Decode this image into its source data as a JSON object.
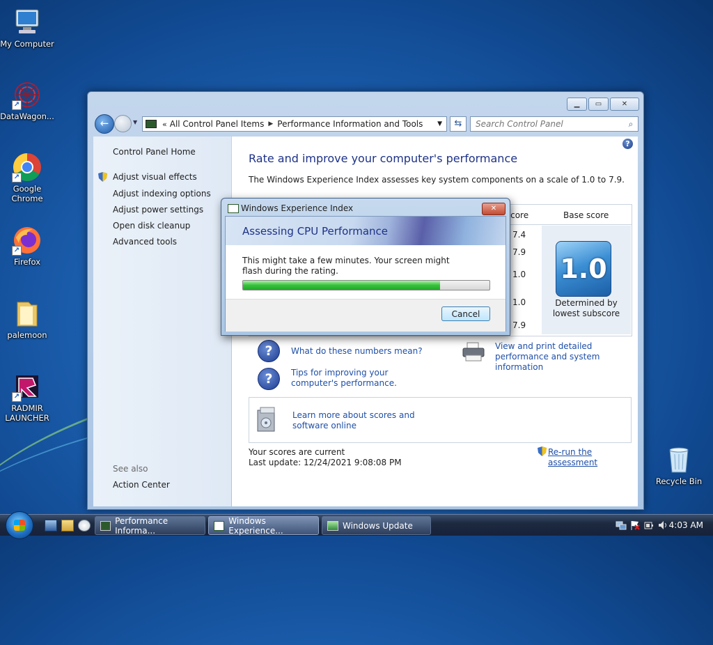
{
  "desktop": {
    "icons": [
      {
        "label": "My Computer"
      },
      {
        "label": "DataWagon..."
      },
      {
        "label": "Google Chrome"
      },
      {
        "label": "Firefox"
      },
      {
        "label": "palemoon"
      },
      {
        "label": "RADMIR LAUNCHER"
      },
      {
        "label": "Recycle Bin"
      }
    ]
  },
  "window": {
    "address": {
      "root": "All Control Panel Items",
      "current": "Performance Information and Tools"
    },
    "search_placeholder": "Search Control Panel",
    "sidebar": {
      "home": "Control Panel Home",
      "links": [
        "Adjust visual effects",
        "Adjust indexing options",
        "Adjust power settings",
        "Open disk cleanup",
        "Advanced tools"
      ],
      "see_also": "See also",
      "action_center": "Action Center"
    },
    "content": {
      "heading": "Rate and improve your computer's performance",
      "description": "The Windows Experience Index assesses key system components on a scale of 1.0 to 7.9.",
      "table": {
        "subscore_header": "Subscore",
        "base_header": "Base score",
        "subscores": [
          "7.4",
          "7.9",
          "1.0",
          "1.0",
          "7.9"
        ],
        "base_score": "1.0",
        "determined": "Determined by",
        "lowest": "lowest subscore"
      },
      "links": {
        "numbers": "What do these numbers mean?",
        "tips": "Tips for improving your computer's performance.",
        "print": "View and print detailed performance and system information",
        "learn": "Learn more about scores and software online"
      },
      "status": "Your scores are current",
      "last_update": "Last update: 12/24/2021 9:08:08 PM",
      "rerun": "Re-run the assessment"
    }
  },
  "dialog": {
    "title": "Windows Experience Index",
    "banner": "Assessing CPU Performance",
    "message": "This might take a few minutes. Your screen might flash during the rating.",
    "progress": 0.8,
    "cancel": "Cancel"
  },
  "taskbar": {
    "buttons": [
      "Performance Informa...",
      "Windows Experience...",
      "Windows Update"
    ],
    "time": "4:03 AM"
  }
}
